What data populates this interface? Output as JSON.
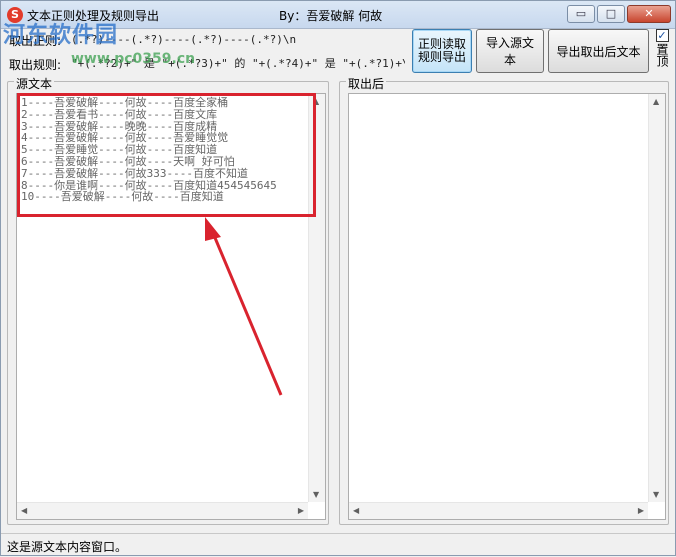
{
  "window": {
    "title": "文本正则处理及规则导出",
    "byline": "By：吾爱破解  何故",
    "controls": {
      "minimize": "▭",
      "maximize": "□",
      "close": "✕"
    }
  },
  "watermark": {
    "text": "河东软件园",
    "url": "www.pc0359.cn"
  },
  "rules": {
    "regex_label": "取出正则:",
    "regex_value": "(.*?)----(.*?)----(.*?)----(.*?)\\n",
    "rule_label": "取出规则:",
    "rule_value": "\"+(.*?2)+\" 是 \"+(.*?3)+\" 的 \"+(.*?4)+\" 是 \"+(.*?1)+\\n"
  },
  "buttons": {
    "read_export": "正则读取\n规则导出",
    "import": "导入源文本",
    "export": "导出取出后文本"
  },
  "topmost": {
    "label": "置顶",
    "checked": true
  },
  "source_panel": {
    "title": "源文本",
    "lines": [
      "1----吾爱破解----何故----百度全家桶",
      "2----吾爱看书----何故----百度文库",
      "3----吾爱破解----晚晚----百度成精",
      "4----吾爱破解----何故----吾爱睡觉觉",
      "5----吾爱睡觉----何故----百度知道",
      "6----吾爱破解----何故----天啊 好可怕",
      "7----吾爱破解----何故333----百度不知道",
      "8----你是谁啊----何故----百度知道454545645",
      "10----吾爱破解----何故----百度知道"
    ]
  },
  "result_panel": {
    "title": "取出后"
  },
  "status": {
    "text": "这是源文本内容窗口。"
  },
  "colors": {
    "highlight": "#d9232e",
    "accent": "#3c7fb1"
  }
}
